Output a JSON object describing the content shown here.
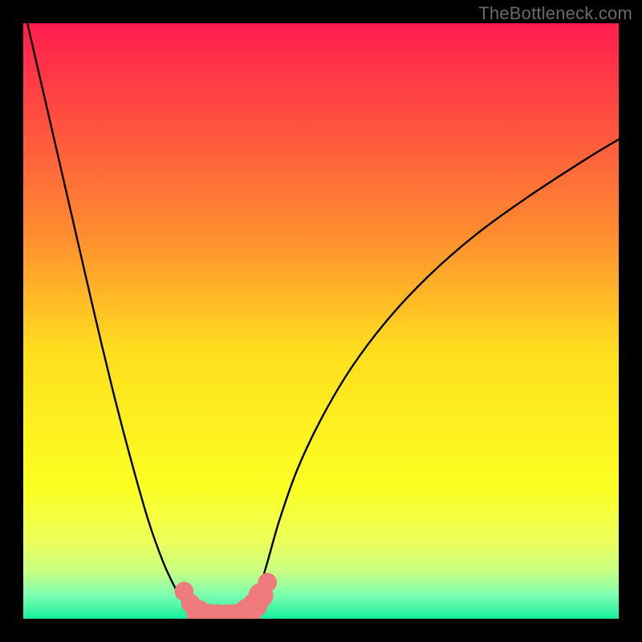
{
  "watermark": "TheBottleneck.com",
  "chart_data": {
    "type": "line",
    "title": "",
    "xlabel": "",
    "ylabel": "",
    "xlim": [
      0,
      100
    ],
    "ylim": [
      0,
      100
    ],
    "grid": false,
    "legend": false,
    "background_gradient": {
      "stops": [
        {
          "offset": 0.0,
          "color": "#ff1c4e"
        },
        {
          "offset": 0.35,
          "color": "#ff8b30"
        },
        {
          "offset": 0.55,
          "color": "#ffde1e"
        },
        {
          "offset": 0.78,
          "color": "#fbff22"
        },
        {
          "offset": 0.87,
          "color": "#ecff5a"
        },
        {
          "offset": 0.92,
          "color": "#c9ff82"
        },
        {
          "offset": 0.96,
          "color": "#7dffb0"
        },
        {
          "offset": 1.0,
          "color": "#16ef9d"
        }
      ]
    },
    "series": [
      {
        "name": "bottleneck-curve",
        "color": "#000000",
        "x": [
          0,
          3,
          6,
          9,
          12,
          15,
          18,
          21,
          23.5,
          25.5,
          27,
          28.3,
          29.5,
          30.5,
          31.7,
          34,
          36.3,
          37.5,
          38.5,
          39.7,
          41,
          43,
          46,
          50,
          55,
          61,
          68,
          76,
          85,
          95,
          100
        ],
        "y": [
          103,
          90,
          77,
          64,
          51,
          38.5,
          27,
          16.5,
          9.5,
          5.2,
          2.6,
          1.2,
          0.55,
          0.35,
          0.55,
          0.35,
          0.55,
          1.2,
          2.6,
          5.2,
          9.5,
          16.5,
          25,
          33.5,
          42,
          50,
          57.5,
          64.5,
          71,
          77.5,
          80.5
        ]
      }
    ],
    "markers": {
      "color": "#ef7b7d",
      "points": [
        {
          "x": 27.0,
          "y": 4.6,
          "r": 1.6
        },
        {
          "x": 28.1,
          "y": 2.6,
          "r": 1.6
        },
        {
          "x": 29.5,
          "y": 1.0,
          "r": 2.1
        },
        {
          "x": 31.1,
          "y": 0.4,
          "r": 2.1
        },
        {
          "x": 32.6,
          "y": 0.35,
          "r": 2.1
        },
        {
          "x": 34.2,
          "y": 0.35,
          "r": 2.1
        },
        {
          "x": 35.7,
          "y": 0.35,
          "r": 2.1
        },
        {
          "x": 37.7,
          "y": 1.1,
          "r": 2.3
        },
        {
          "x": 38.9,
          "y": 2.3,
          "r": 2.1
        },
        {
          "x": 39.9,
          "y": 3.9,
          "r": 2.1
        },
        {
          "x": 41.0,
          "y": 6.1,
          "r": 1.6
        }
      ]
    }
  }
}
